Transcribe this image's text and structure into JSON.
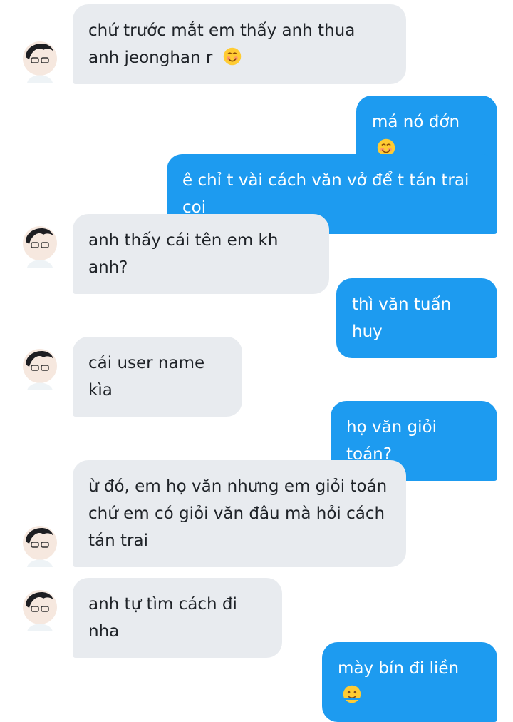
{
  "conversation": {
    "messages": [
      {
        "side": "in",
        "text": "chứ trước mắt em thấy anh thua anh jeonghan r",
        "emoji": "smiling-blush-emoji"
      },
      {
        "side": "out",
        "text": "má nó đớn",
        "emoji": "smiling-blush-emoji"
      },
      {
        "side": "out",
        "text": "ê chỉ t vài cách văn vở để t tán trai coi"
      },
      {
        "side": "in",
        "text": "anh thấy cái tên em kh anh?"
      },
      {
        "side": "out",
        "text": "thì văn tuấn huy"
      },
      {
        "side": "in",
        "text": "cái user name kìa"
      },
      {
        "side": "out",
        "text": "họ văn giỏi toán?"
      },
      {
        "side": "in",
        "text": "ừ đó, em họ văn nhưng em giỏi toán chứ em có giỏi văn đâu mà hỏi cách tán trai"
      },
      {
        "side": "in",
        "text": "anh tự tìm cách đi nha"
      },
      {
        "side": "out",
        "text": "mày bín đi liền",
        "emoji": "slight-smile-emoji"
      }
    ]
  },
  "colors": {
    "outgoing_bubble": "#1d9bf0",
    "incoming_bubble": "#e8ebef",
    "incoming_text": "#1f2328",
    "outgoing_text": "#ffffff"
  }
}
